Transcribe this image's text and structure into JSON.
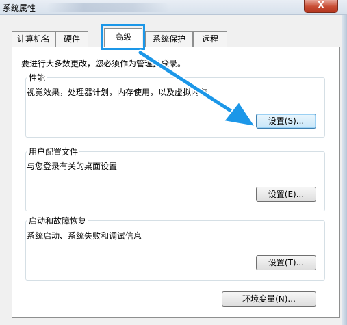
{
  "window": {
    "title": "系统属性",
    "close_symbol": "X"
  },
  "tabs": [
    {
      "label": "计算机名"
    },
    {
      "label": "硬件"
    },
    {
      "label": "高级",
      "selected": true
    },
    {
      "label": "系统保护"
    },
    {
      "label": "远程"
    }
  ],
  "notice": "要进行大多数更改，您必须作为管理员登录。",
  "performance": {
    "title": "性能",
    "description": "视觉效果，处理器计划，内存使用，以及虚拟内存",
    "button_label": "设置(S)..."
  },
  "user_profiles": {
    "title": "用户配置文件",
    "description": "与您登录有关的桌面设置",
    "button_label": "设置(E)..."
  },
  "startup_recovery": {
    "title": "启动和故障恢复",
    "description": "系统启动、系统失败和调试信息",
    "button_label": "设置(T)..."
  },
  "env_button_label": "环境变量(N)...",
  "colors": {
    "highlight": "#1c97e8",
    "arrow": "#1c97e8",
    "close_button": "#c74b32"
  },
  "icons": [
    "close-icon",
    "arrow-annotation-icon"
  ]
}
